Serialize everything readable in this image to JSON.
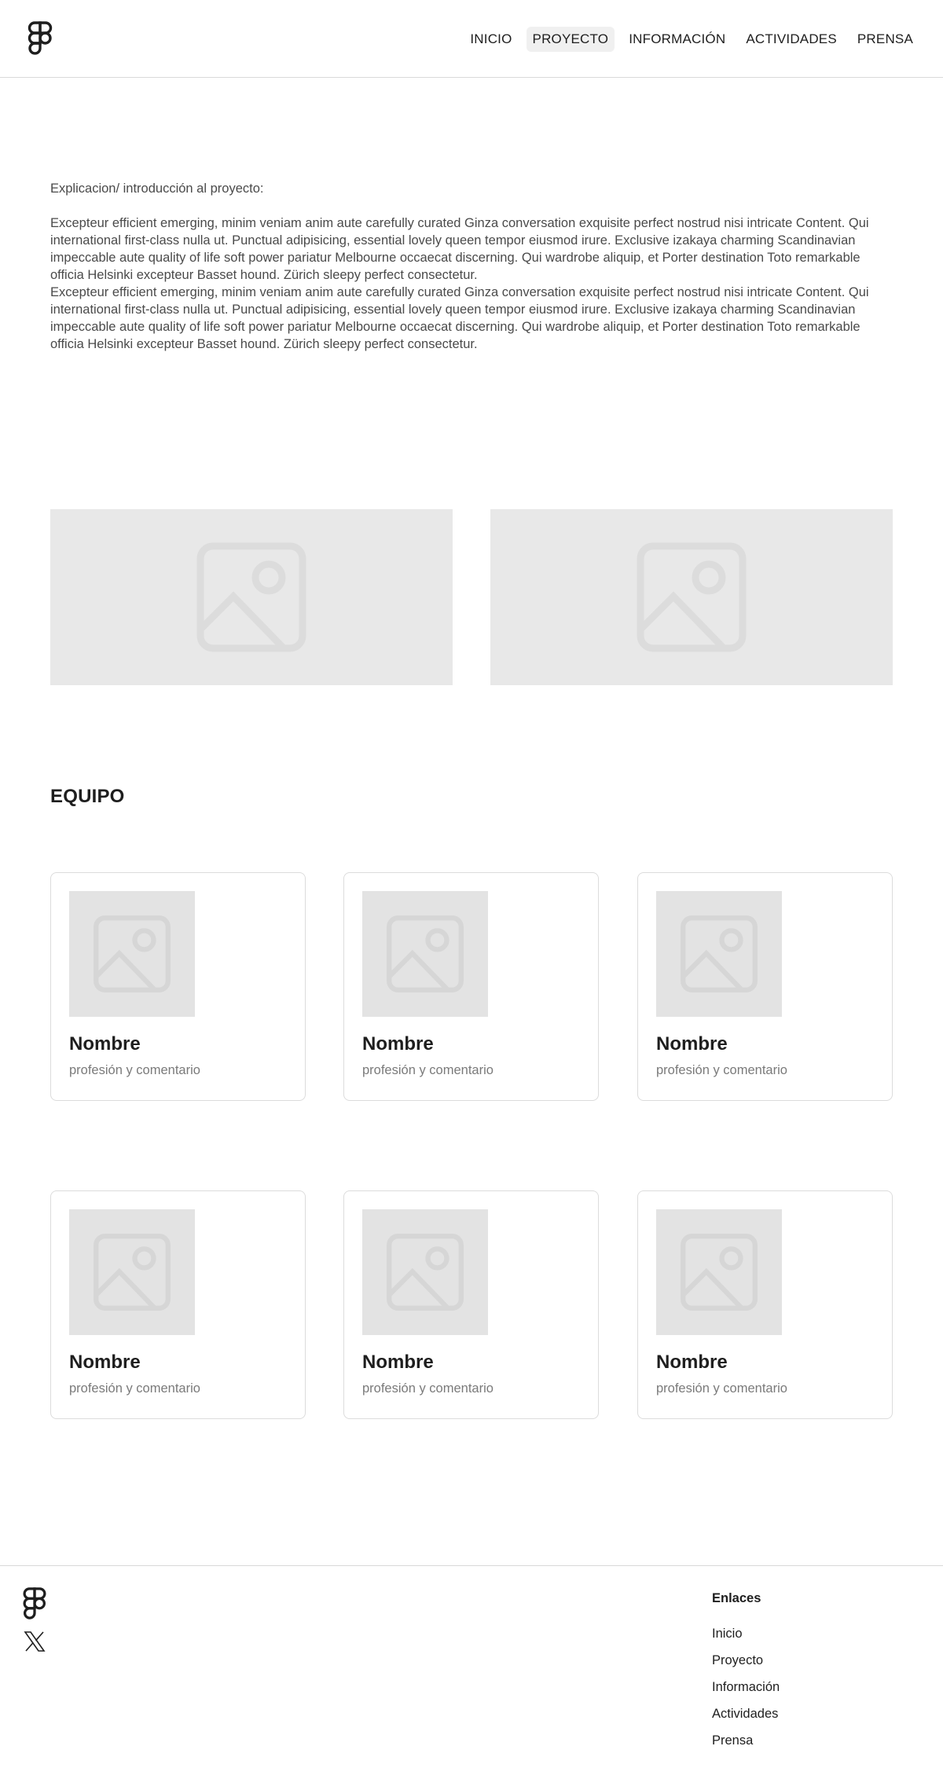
{
  "header": {
    "logo_icon": "figma-logo-icon",
    "nav": [
      {
        "label": "INICIO",
        "active": false
      },
      {
        "label": "PROYECTO",
        "active": true
      },
      {
        "label": "INFORMACIÓN",
        "active": false
      },
      {
        "label": "ACTIVIDADES",
        "active": false
      },
      {
        "label": "PRENSA",
        "active": false
      }
    ]
  },
  "intro": {
    "lead": "Explicacion/ introducción al proyecto:",
    "body": "Excepteur efficient emerging, minim veniam anim aute carefully curated Ginza conversation exquisite perfect nostrud nisi intricate Content. Qui  international first-class nulla ut. Punctual adipisicing, essential lovely queen tempor eiusmod irure. Exclusive izakaya charming Scandinavian impeccable aute quality of life soft power pariatur Melbourne occaecat discerning. Qui wardrobe aliquip, et Porter destination Toto remarkable officia Helsinki excepteur Basset hound. Zürich sleepy perfect consectetur.\nExcepteur efficient emerging, minim veniam anim aute carefully curated Ginza conversation exquisite perfect nostrud nisi intricate Content. Qui  international first-class nulla ut. Punctual adipisicing, essential lovely queen tempor eiusmod irure. Exclusive izakaya charming Scandinavian impeccable aute quality of life soft power pariatur Melbourne occaecat discerning. Qui wardrobe aliquip, et Porter destination Toto remarkable officia Helsinki excepteur Basset hound. Zürich sleepy perfect consectetur."
  },
  "team": {
    "title": "EQUIPO",
    "members": [
      {
        "name": "Nombre",
        "desc": "profesión y comentario"
      },
      {
        "name": "Nombre",
        "desc": "profesión y comentario"
      },
      {
        "name": "Nombre",
        "desc": "profesión y comentario"
      },
      {
        "name": "Nombre",
        "desc": "profesión y comentario"
      },
      {
        "name": "Nombre",
        "desc": "profesión y comentario"
      },
      {
        "name": "Nombre",
        "desc": "profesión y comentario"
      }
    ]
  },
  "footer": {
    "logo_icon": "figma-logo-icon",
    "social_icon": "x-twitter-icon",
    "links_title": "Enlaces",
    "links": [
      "Inicio",
      "Proyecto",
      "Información",
      "Actividades",
      "Prensa"
    ]
  },
  "colors": {
    "placeholder_bg": "#e8e8e8",
    "border": "#d9d9d9",
    "text": "#1e1e1e",
    "muted": "#7a7a7a"
  }
}
